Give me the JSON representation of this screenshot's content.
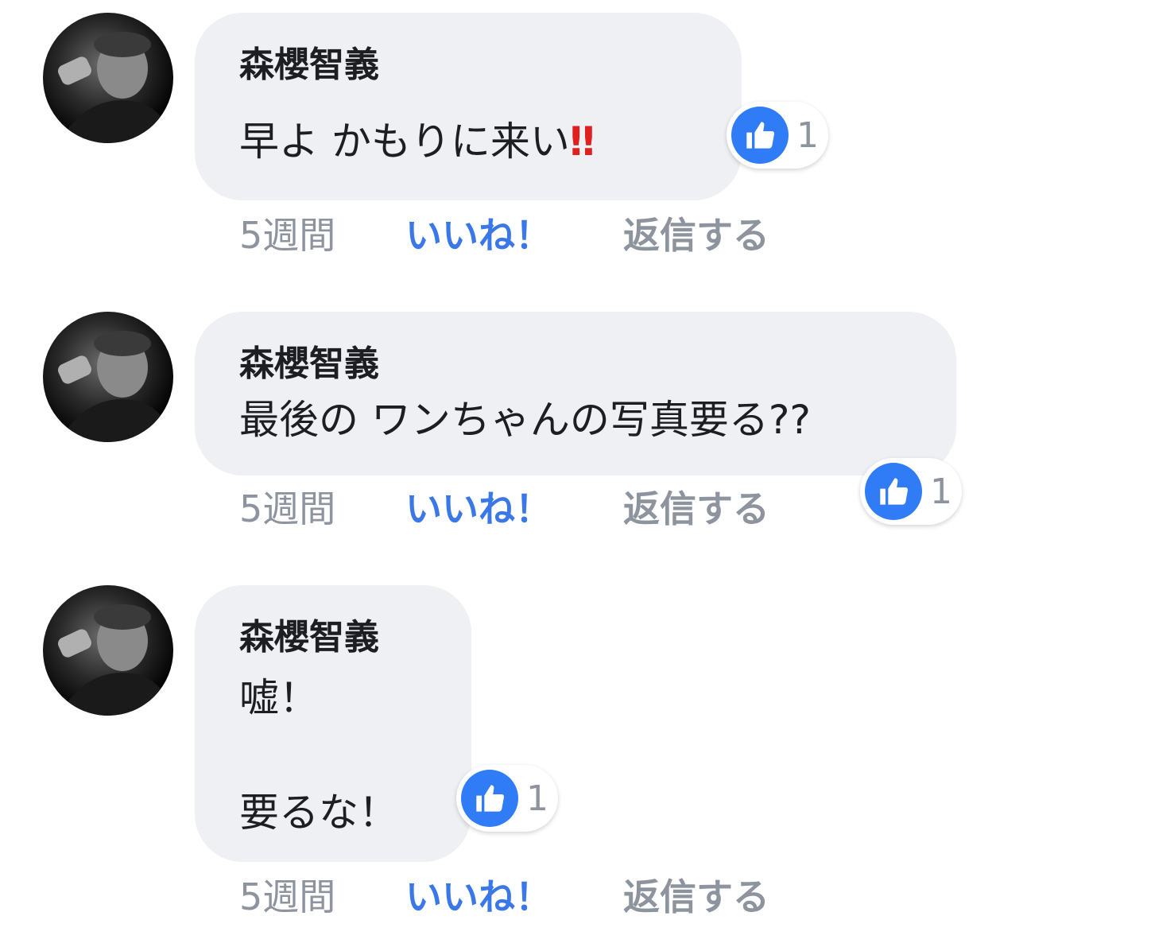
{
  "comments": [
    {
      "author": "森櫻智義",
      "text_main": "早よ かもりに来い",
      "text_emphasis": "‼",
      "time": "5週間",
      "like_label": "いいね！",
      "reply_label": "返信する",
      "reaction_count": "1",
      "reaction_icon": "thumbs-up-icon"
    },
    {
      "author": "森櫻智義",
      "text_main": "最後の ワンちゃんの写真要る??",
      "time": "5週間",
      "like_label": "いいね！",
      "reply_label": "返信する",
      "reaction_count": "1",
      "reaction_icon": "thumbs-up-icon"
    },
    {
      "author": "森櫻智義",
      "text_main": "嘘！\n\n要るな！",
      "time": "5週間",
      "like_label": "いいね！",
      "reply_label": "返信する",
      "reaction_count": "1",
      "reaction_icon": "thumbs-up-icon"
    }
  ],
  "colors": {
    "bubble": "#eff0f3",
    "like_blue": "#3b78e7",
    "meta_gray": "#8d949e",
    "emphasis_red": "#e02020"
  }
}
